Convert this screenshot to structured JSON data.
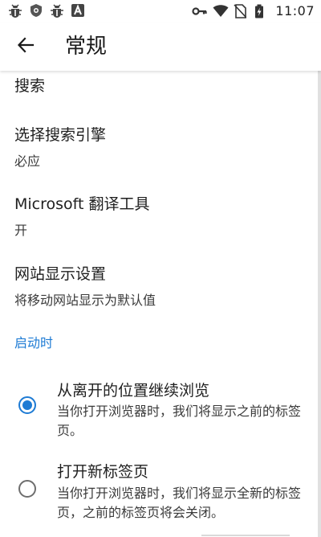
{
  "status_bar": {
    "time": "11:07",
    "left_icons": [
      "bug-icon",
      "shield-icon",
      "bug-icon",
      "a-box-icon"
    ],
    "right_icons": [
      "key-icon",
      "wifi-icon",
      "no-sim-icon",
      "battery-icon"
    ]
  },
  "app_bar": {
    "back_icon": "arrow-back-icon",
    "title": "常规"
  },
  "settings": {
    "search": {
      "title": "搜索"
    },
    "engine": {
      "title": "选择搜索引擎",
      "value": "必应"
    },
    "translator": {
      "title": "Microsoft 翻译工具",
      "value": "开"
    },
    "site_display": {
      "title": "网站显示设置",
      "value": "将移动网站显示为默认值"
    }
  },
  "startup": {
    "header": "启动时",
    "options": [
      {
        "title": "从离开的位置继续浏览",
        "description": "当你打开浏览器时，我们将显示之前的标签页。",
        "selected": true
      },
      {
        "title": "打开新标签页",
        "description": "当你打开浏览器时，我们将显示全新的标签页，之前的标签页将会关闭。",
        "selected": false
      }
    ]
  },
  "colors": {
    "accent": "#1e7bd4",
    "text_primary": "#1f1f1f",
    "text_secondary": "#3a3a3a"
  }
}
